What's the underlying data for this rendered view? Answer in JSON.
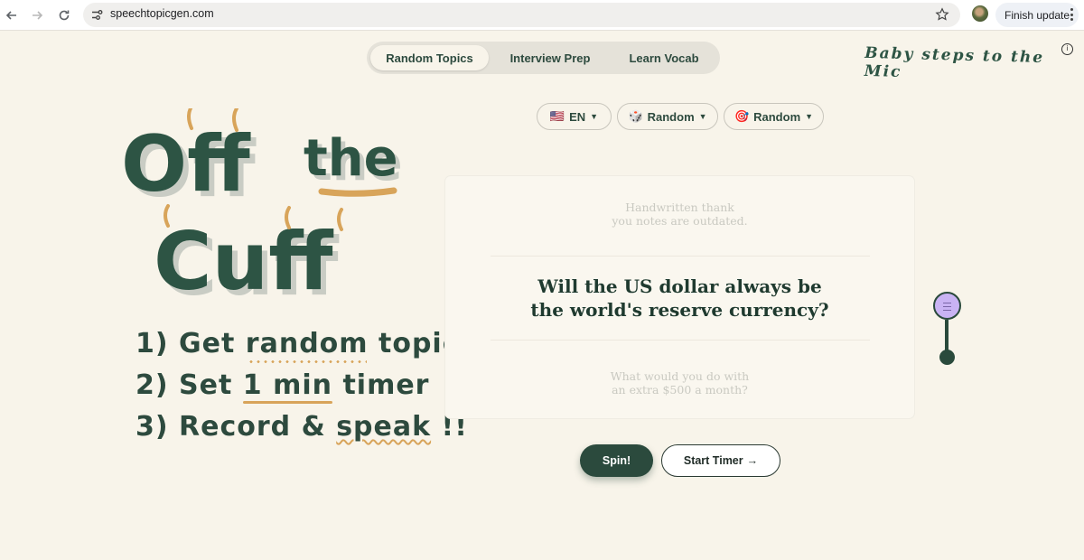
{
  "browser": {
    "url": "speechtopicgen.com",
    "update_label": "Finish update"
  },
  "tabs": [
    {
      "label": "Random Topics",
      "active": true
    },
    {
      "label": "Interview Prep",
      "active": false
    },
    {
      "label": "Learn Vocab",
      "active": false
    }
  ],
  "brand": {
    "text": "Baby steps to the Mic",
    "info_glyph": "i"
  },
  "hero": {
    "line1_a": "Off",
    "line1_b": "the",
    "line2": "Cuff",
    "colors": {
      "green": "#2d5444",
      "shadow": "#c9ccc4",
      "accent": "#d8a45a"
    }
  },
  "steps": {
    "s1_prefix": "1) Get ",
    "s1_highlight": "random",
    "s1_suffix": " topic",
    "s2_prefix": "2) Set ",
    "s2_highlight": "1 min",
    "s2_suffix": " timer",
    "s3_prefix": "3) Record & ",
    "s3_highlight": "speak",
    "s3_suffix": " !!"
  },
  "filters": [
    {
      "icon": "🇺🇸",
      "label": "EN"
    },
    {
      "icon": "🎲",
      "label": "Random"
    },
    {
      "icon": "🎯",
      "label": "Random"
    }
  ],
  "card": {
    "prev_topic": [
      "Handwritten thank",
      "you notes are outdated."
    ],
    "current_topic": [
      "Will the US dollar always be",
      "the world's reserve currency?"
    ],
    "next_topic": [
      "What would you do with",
      "an extra $500 a month?"
    ]
  },
  "actions": {
    "spin": "Spin!",
    "start_timer": "Start Timer",
    "arrow": "→"
  }
}
